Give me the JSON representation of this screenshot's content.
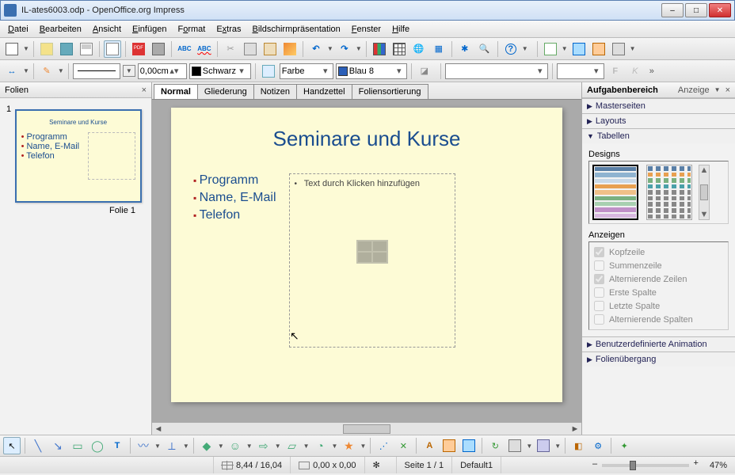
{
  "window": {
    "title": "IL-ates6003.odp - OpenOffice.org Impress"
  },
  "menu": [
    "Datei",
    "Bearbeiten",
    "Ansicht",
    "Einfügen",
    "Format",
    "Extras",
    "Bildschirmpräsentation",
    "Fenster",
    "Hilfe"
  ],
  "toolbar2": {
    "line_width": "0,00cm",
    "line_color_label": "Schwarz",
    "fill_mode_label": "Farbe",
    "fill_color_label": "Blau 8"
  },
  "slides_panel": {
    "title": "Folien",
    "slide_number": "1",
    "caption": "Folie 1"
  },
  "view_tabs": [
    "Normal",
    "Gliederung",
    "Notizen",
    "Handzettel",
    "Foliensortierung"
  ],
  "slide": {
    "title": "Seminare und Kurse",
    "bullets": [
      "Programm",
      "Name, E-Mail",
      "Telefon"
    ],
    "placeholder": "Text durch Klicken hinzufügen"
  },
  "task_pane": {
    "title": "Aufgabenbereich",
    "view_link": "Anzeige",
    "sections": {
      "master": "Masterseiten",
      "layouts": "Layouts",
      "tables": "Tabellen",
      "designs_label": "Designs",
      "show_label": "Anzeigen",
      "opts": {
        "header": "Kopfzeile",
        "sumrow": "Summenzeile",
        "altrows": "Alternierende Zeilen",
        "firstcol": "Erste Spalte",
        "lastcol": "Letzte Spalte",
        "altcols": "Alternierende Spalten"
      },
      "custom_anim": "Benutzerdefinierte Animation",
      "transition": "Folienübergang"
    }
  },
  "status": {
    "pos": "8,44 / 16,04",
    "size": "0,00 x 0,00",
    "page": "Seite 1 / 1",
    "template": "Default1",
    "zoom": "47%"
  }
}
